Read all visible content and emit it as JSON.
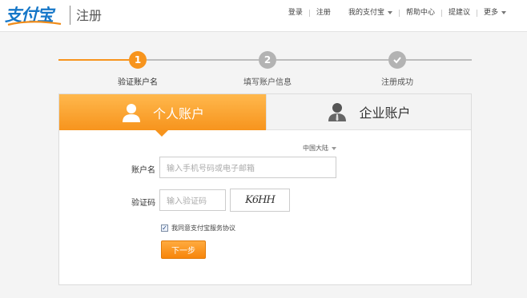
{
  "brand": {
    "logo_text": "支付宝",
    "page_title": "注册",
    "accent": "#f7941d",
    "blue": "#1677c8"
  },
  "nav": {
    "items": [
      {
        "label": "登录",
        "dropdown": false
      },
      {
        "label": "注册",
        "dropdown": false
      },
      {
        "label": "我的支付宝",
        "dropdown": true
      },
      {
        "label": "帮助中心",
        "dropdown": false
      },
      {
        "label": "提建议",
        "dropdown": false
      },
      {
        "label": "更多",
        "dropdown": true
      }
    ]
  },
  "steps": [
    {
      "number": "1",
      "label": "验证账户名",
      "state": "current"
    },
    {
      "number": "2",
      "label": "填写账户信息",
      "state": "pending"
    },
    {
      "number": "",
      "label": "注册成功",
      "state": "pending"
    }
  ],
  "tabs": {
    "personal": {
      "label": "个人账户",
      "selected": true
    },
    "enterprise": {
      "label": "企业账户",
      "selected": false
    }
  },
  "form": {
    "region": "中国大陆",
    "account_label": "账户名",
    "account_placeholder": "输入手机号码或电子邮箱",
    "captcha_label": "验证码",
    "captcha_placeholder": "输入验证码",
    "captcha_image_text": "K6HH",
    "agree_text": "我同意支付宝服务协议",
    "agree_checked": true,
    "next_label": "下一步"
  }
}
